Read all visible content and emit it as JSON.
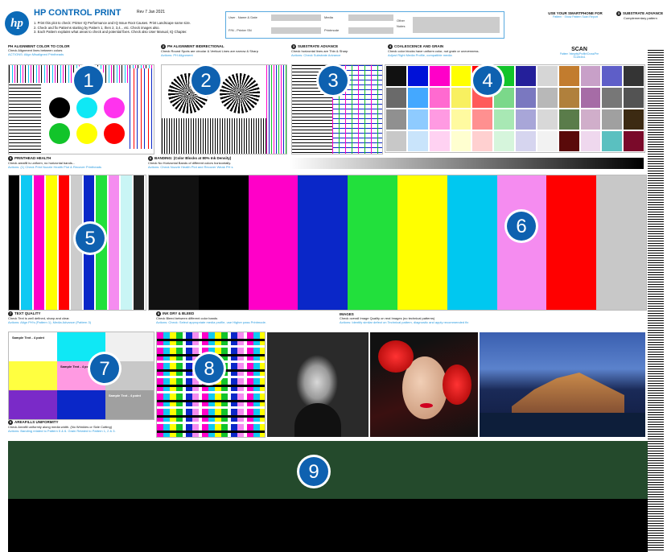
{
  "header": {
    "logo": "hp",
    "title": "HP CONTROL PRINT",
    "rev": "Rev 7 Jan 2021",
    "instructions": [
      "1. Print this plot to check: Printer IQ Performance and IQ Issue Root Causes. Print Landscape same size.",
      "2. Check and fix Patterns starting by Pattern 1, then 2, 3,4... etc. Check images also.",
      "3. Each Pattern explains what areas to check and potential fixes. Check also User Manual, IQ Chapter."
    ],
    "fields": {
      "user": "User . Name & Date",
      "pn": "P/N - Printer SN",
      "media": "Media",
      "printmode": "Printmode",
      "other": "Other",
      "notes": "Notes"
    },
    "smartphone": "USE YOUR SMARTPHONE FOR",
    "smartphone_sub": "Pattern · Show Pattern Scan Report",
    "substrate_title": "SUBSTRATE ADVANCE",
    "substrate_sub": "Complementary pattern"
  },
  "sections": {
    "s1": {
      "title": "PH ALIGNMENT COLOR TO COLOR",
      "desc": "Check Alignment lines between colors",
      "action": "ACTIONS: Align Misaligned Printheads"
    },
    "s2": {
      "title": "PH ALIGNMENT BIDIRECTIONAL",
      "desc": "Check Round Spots are circular & Vertical Lines are narrow & Sharp",
      "action": "Actions: PH Alignment"
    },
    "s3": {
      "title": "SUBSTRATE ADVANCE",
      "desc": "Check horizontal lines are Thin & Sharp",
      "action": "Actions: Check Substrate Advance"
    },
    "s4": {
      "title": "COALESCENCE AND GRAIN",
      "desc": "Check color blocks have uniform color, not grain or unevenness.",
      "action": "Adjust Right Media Profile, compatible media"
    },
    "scan": "SCAN",
    "scan_sub": "Pattern 'Integrity/Profile/Cross/Pre SCAN4to1",
    "s5": {
      "title": "PRINTHEAD HEALTH",
      "desc": "Check areafill is uniform, no horizontal bands...",
      "action": "Actions: (1) Check Print Nozzle Health Plot & Recover Printheads"
    },
    "s6": {
      "title": "BANDING: (Color Blocks at 80% Ink Density)",
      "desc": "Check No Horizontal Bands of different colors horizontally.",
      "action": "Actions: Check Nozzle Health Plot and Recover Weak PH s"
    },
    "s7": {
      "title": "TEXT QUALITY",
      "desc": "Check Text is well defined, sharp and clear.",
      "action": "Actions: Align PH's (Pattern 1), Media Advance (Pattern 3)"
    },
    "s8": {
      "title": "INK DRY & BLEED",
      "desc": "Check Bleed between different color bands",
      "action": "Actions: Check: Select appropriate media profile, use Higher pass Printmode."
    },
    "images": {
      "title": "IMAGES",
      "desc": "Check overall Image Quality on real Images (no technical patterns)",
      "action": "Actions: Identify similar defect on Technical pattern, diagnostic and apply recommended fix"
    },
    "s9": {
      "title": "AREAFILLS UNIFORMITY",
      "desc": "Check Areafill uniformly along media width. (No Wrinkles or Side Cutting)",
      "action": "Actions: Banding related to Pattern 5 & 6. Grain Related to Pattern 1, 2 & 3."
    }
  },
  "badges": [
    "1",
    "2",
    "3",
    "4",
    "5",
    "6",
    "7",
    "8",
    "9"
  ],
  "sample_text": "Sample Text - 4 point",
  "colors": {
    "accent": "#0b6ab7",
    "green": "#244a2c",
    "banding": [
      "#111111",
      "#000000",
      "#ff00c8",
      "#0a27c8",
      "#22e03c",
      "#ffff00",
      "#00c8f0",
      "#f58cf0",
      "#ff0000",
      "#c8c8c8"
    ],
    "ph": [
      "#000000",
      "#0fc9f3",
      "#ff00c8",
      "#ffff00",
      "#ff0000",
      "#cccccc",
      "#0a27c8",
      "#22e03c",
      "#f58cf0",
      "#c9f5f5",
      "#222222"
    ],
    "coal_row1": [
      "#111111",
      "#0011d8",
      "#ff00c8",
      "#ffff00",
      "#ff0000",
      "#12c42a",
      "#241f9a",
      "#d6d6d6",
      "#c27c2e",
      "#c8a0c8",
      "#5e5ec8",
      "#343434"
    ],
    "coal_row2": [
      "#6a6a6a",
      "#44a8ff",
      "#ff6ad0",
      "#f8f060",
      "#ff5a5a",
      "#7bd88a",
      "#7a78c0",
      "#b8b8b8",
      "#b0803c",
      "#a66ca6",
      "#777777",
      "#535353"
    ],
    "coal_row3": [
      "#909090",
      "#8ecbff",
      "#ff9ae2",
      "#fffaa0",
      "#ff9090",
      "#a8e8b4",
      "#a8a6d8",
      "#d8d8d8",
      "#5a7c4a",
      "#d0aeca",
      "#a0a0a0",
      "#3c2a12"
    ],
    "coal_row4": [
      "#c8c8c8",
      "#c9e4fb",
      "#ffd2f2",
      "#ffffd0",
      "#ffd0d0",
      "#d6f5dc",
      "#d6d5ef",
      "#f2f2f2",
      "#5a0a0a",
      "#efd8ee",
      "#5ac0c0",
      "#7a0a2a"
    ]
  }
}
